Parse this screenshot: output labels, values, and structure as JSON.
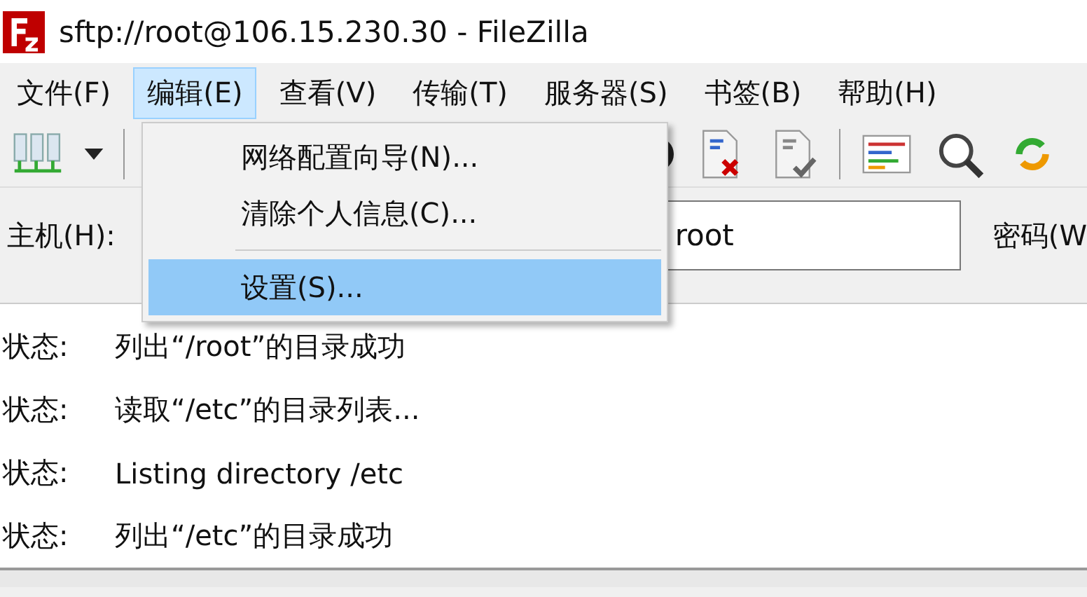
{
  "window": {
    "title": "sftp://root@106.15.230.30 - FileZilla"
  },
  "menubar": [
    {
      "label": "文件(F)",
      "selected": false
    },
    {
      "label": "编辑(E)",
      "selected": true
    },
    {
      "label": "查看(V)",
      "selected": false
    },
    {
      "label": "传输(T)",
      "selected": false
    },
    {
      "label": "服务器(S)",
      "selected": false
    },
    {
      "label": "书签(B)",
      "selected": false
    },
    {
      "label": "帮助(H)",
      "selected": false
    }
  ],
  "open_menu": {
    "items": [
      {
        "kind": "item",
        "label": "网络配置向导(N)...",
        "selected": false
      },
      {
        "kind": "item",
        "label": "清除个人信息(C)...",
        "selected": false
      },
      {
        "kind": "separator"
      },
      {
        "kind": "item",
        "label": "设置(S)...",
        "selected": true
      }
    ]
  },
  "quickconnect": {
    "host_label": "主机(H):",
    "user_value": "root",
    "password_label": "密码(W"
  },
  "log": [
    {
      "label": "状态:",
      "message": "列出“/root”的目录成功"
    },
    {
      "label": "状态:",
      "message": "读取“/etc”的目录列表..."
    },
    {
      "label": "状态:",
      "message": "Listing directory /etc"
    },
    {
      "label": "状态:",
      "message": "列出“/etc”的目录成功"
    }
  ]
}
